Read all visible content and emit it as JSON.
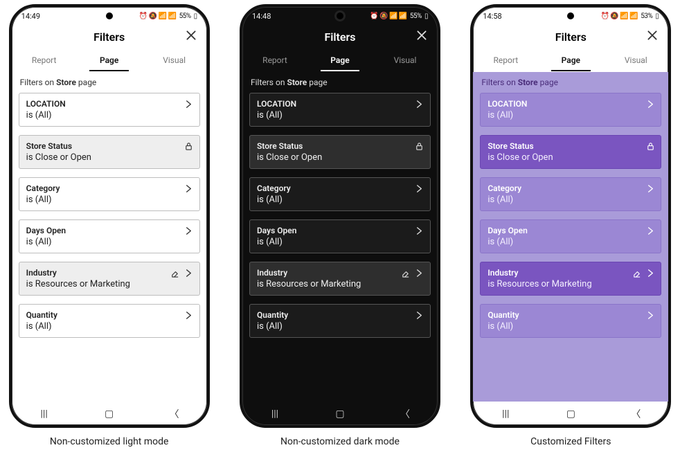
{
  "captions": {
    "light": "Non-customized light mode",
    "dark": "Non-customized dark mode",
    "purple": "Customized Filters"
  },
  "status": {
    "light_time": "14:49",
    "dark_time": "14:48",
    "purple_time": "14:58",
    "light_batt": "55%",
    "dark_batt": "55%",
    "purple_batt": "53%",
    "indicators": "⏰ 🔕 📶 📶"
  },
  "header": {
    "title": "Filters"
  },
  "tabs": {
    "report": "Report",
    "page": "Page",
    "visual": "Visual"
  },
  "section": {
    "prefix": "Filters on ",
    "bold": "Store",
    "suffix": " page"
  },
  "filters": [
    {
      "title": "LOCATION",
      "value": "is (All)",
      "chevron": true,
      "lock": false,
      "eraser": false,
      "applied": false
    },
    {
      "title": "Store Status",
      "value": "is Close or Open",
      "chevron": false,
      "lock": true,
      "eraser": false,
      "applied": true
    },
    {
      "title": "Category",
      "value": "is (All)",
      "chevron": true,
      "lock": false,
      "eraser": false,
      "applied": false
    },
    {
      "title": "Days Open",
      "value": "is (All)",
      "chevron": true,
      "lock": false,
      "eraser": false,
      "applied": false
    },
    {
      "title": "Industry",
      "value": "is Resources or Marketing",
      "chevron": true,
      "lock": false,
      "eraser": true,
      "applied": true
    },
    {
      "title": "Quantity",
      "value": "is (All)",
      "chevron": true,
      "lock": false,
      "eraser": false,
      "applied": false
    }
  ]
}
